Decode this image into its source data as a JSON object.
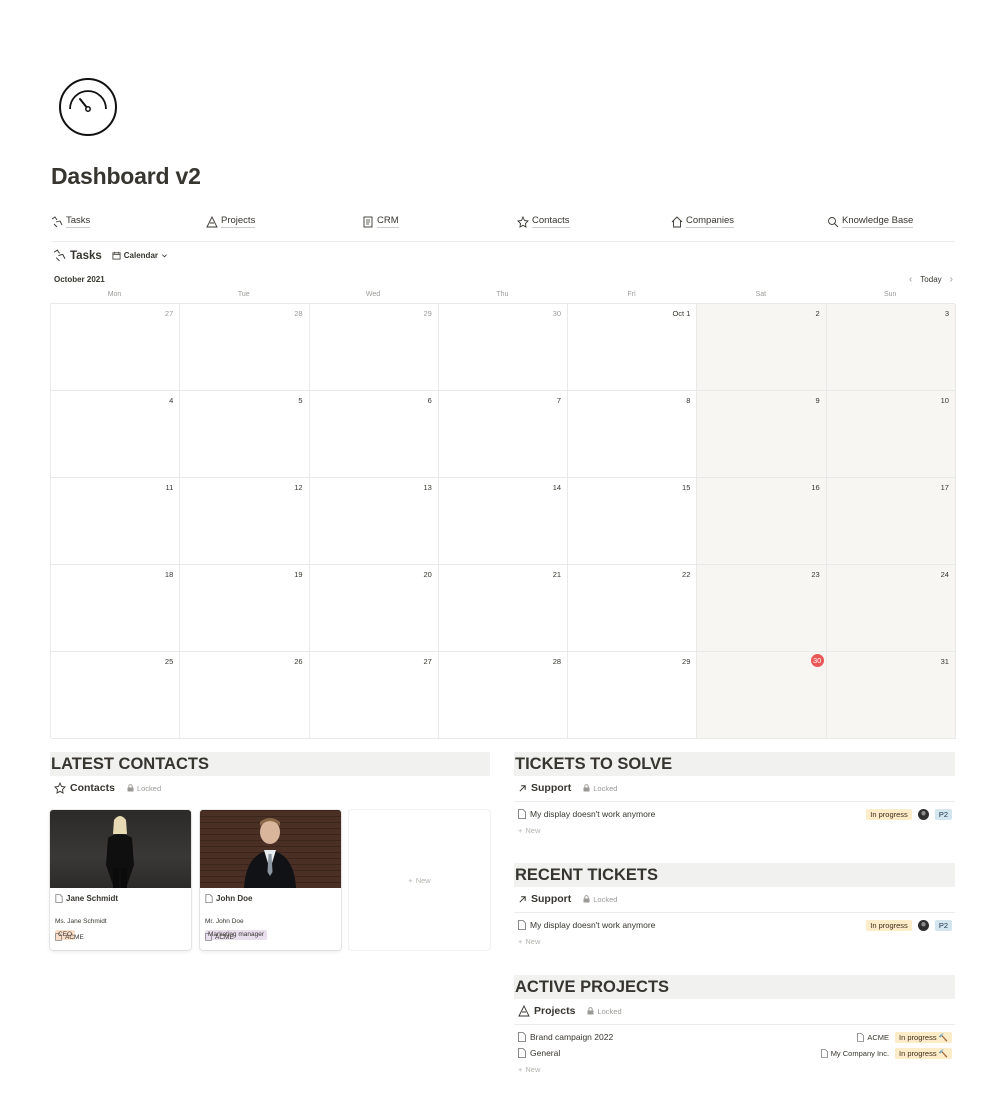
{
  "page": {
    "title": "Dashboard v2",
    "icon": "gauge-icon"
  },
  "nav": [
    {
      "label": "Tasks",
      "icon": "tasks-icon"
    },
    {
      "label": "Projects",
      "icon": "projects-icon"
    },
    {
      "label": "CRM",
      "icon": "crm-icon"
    },
    {
      "label": "Contacts",
      "icon": "contacts-icon"
    },
    {
      "label": "Companies",
      "icon": "companies-icon"
    },
    {
      "label": "Knowledge Base",
      "icon": "knowledge-base-icon"
    }
  ],
  "calendar": {
    "db_title": "Tasks",
    "view_label": "Calendar",
    "month": "October 2021",
    "today_label": "Today",
    "weekdays": [
      "Mon",
      "Tue",
      "Wed",
      "Thu",
      "Fri",
      "Sat",
      "Sun"
    ],
    "weeks": [
      [
        "27",
        "28",
        "29",
        "30",
        "Oct 1",
        "2",
        "3"
      ],
      [
        "4",
        "5",
        "6",
        "7",
        "8",
        "9",
        "10"
      ],
      [
        "11",
        "12",
        "13",
        "14",
        "15",
        "16",
        "17"
      ],
      [
        "18",
        "19",
        "20",
        "21",
        "22",
        "23",
        "24"
      ],
      [
        "25",
        "26",
        "27",
        "28",
        "29",
        "30",
        "31"
      ]
    ],
    "today": "30"
  },
  "latest_contacts": {
    "heading": "LATEST CONTACTS",
    "db_title": "Contacts",
    "locked_label": "Locked",
    "cards": [
      {
        "name": "Jane Schmidt",
        "full_name": "Ms. Jane Schmidt",
        "role": "CEO",
        "company": "ACME"
      },
      {
        "name": "John Doe",
        "full_name": "Mr. John Doe",
        "role": "Marketing manager",
        "company": "ACME"
      }
    ],
    "new_label": "New"
  },
  "tickets_to_solve": {
    "heading": "TICKETS TO SOLVE",
    "db_title": "Support",
    "locked_label": "Locked",
    "rows": [
      {
        "title": "My display doesn't work anymore",
        "status": "In progress",
        "priority": "P2"
      }
    ],
    "new_label": "New"
  },
  "recent_tickets": {
    "heading": "RECENT TICKETS",
    "db_title": "Support",
    "locked_label": "Locked",
    "rows": [
      {
        "title": "My display doesn't work anymore",
        "status": "In progress",
        "priority": "P2"
      }
    ],
    "new_label": "New"
  },
  "active_projects": {
    "heading": "ACTIVE PROJECTS",
    "db_title": "Projects",
    "locked_label": "Locked",
    "rows": [
      {
        "title": "Brand campaign 2022",
        "company": "ACME",
        "status": "In progress 🔨"
      },
      {
        "title": "General",
        "company": "My Company Inc.",
        "status": "In progress 🔨"
      }
    ],
    "new_label": "New"
  },
  "colors": {
    "today_badge": "#eb5757",
    "status_bg": "#fdecc8",
    "priority_bg": "#d3e5ef",
    "role_ceo_bg": "#fadec9",
    "role_marketing_bg": "#e8deee",
    "section_bg": "#f1f1ef"
  }
}
